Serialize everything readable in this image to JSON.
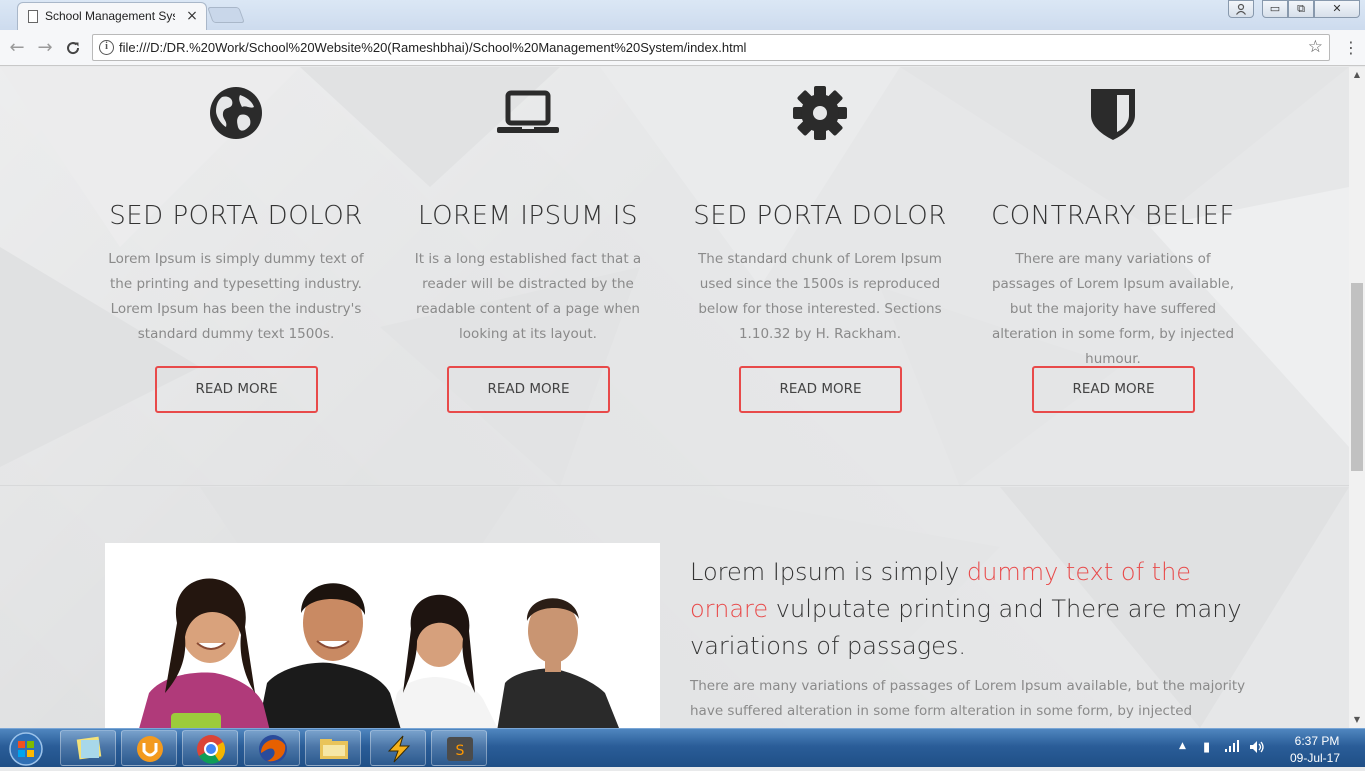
{
  "browser": {
    "tab_title": "School Management Sys",
    "tab_close": "×",
    "url": "file:///D:/DR.%20Work/School%20Website%20(Rameshbhai)/School%20Management%20System/index.html",
    "info_icon": "i",
    "bookmark_star": "☆",
    "menu_icon": "⋮",
    "back": "←",
    "forward": "→",
    "reload": "C",
    "window": {
      "minimize": "▭",
      "maximize": "⧉",
      "close": "✕"
    }
  },
  "features": [
    {
      "icon": "globe-icon",
      "title": "SED PORTA DOLOR",
      "text": "Lorem Ipsum is simply dummy text of the printing and typesetting industry. Lorem Ipsum has been the industry's standard dummy text 1500s.",
      "button": "READ MORE"
    },
    {
      "icon": "laptop-icon",
      "title": "LOREM IPSUM IS",
      "text": "It is a long established fact that a reader will be distracted by the readable content of a page when looking at its layout.",
      "button": "READ MORE"
    },
    {
      "icon": "gear-icon",
      "title": "SED PORTA DOLOR",
      "text": "The standard chunk of Lorem Ipsum used since the 1500s is reproduced below for those interested. Sections 1.10.32 by H. Rackham.",
      "button": "READ MORE"
    },
    {
      "icon": "shield-icon",
      "title": "CONTRARY BELIEF",
      "text": "There are many variations of passages of Lorem Ipsum available, but the majority have suffered alteration in some form, by injected humour.",
      "button": "READ MORE"
    }
  ],
  "about": {
    "headline_start": "Lorem Ipsum is simply ",
    "headline_accent": "dummy text of the ornare",
    "headline_end": " vulputate printing and There are many variations of passages.",
    "body": "There are many variations of passages of Lorem Ipsum available, but the majority have suffered alteration in some form alteration in some form, by injected humour,"
  },
  "taskbar": {
    "time": "6:37 PM",
    "date": "09-Jul-17"
  },
  "colors": {
    "accent": "#e84a4a",
    "icon_dark": "#2b2b2b",
    "heading": "#333333",
    "body_text": "#8a8a8a"
  }
}
